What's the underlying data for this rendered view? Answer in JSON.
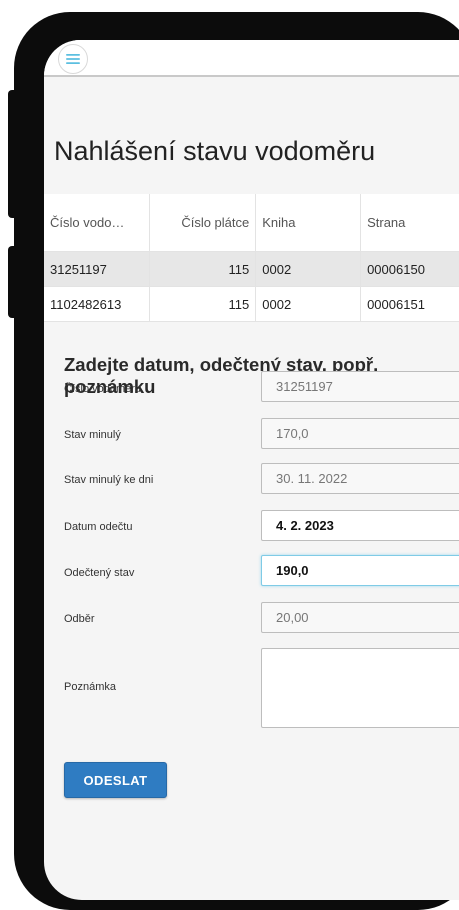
{
  "colors": {
    "accent": "#2f7cc2",
    "focus_border": "#7fcbe6",
    "menu_icon": "#5bbfe0"
  },
  "header": {
    "menu_icon": "hamburger-menu-icon"
  },
  "page": {
    "title": "Nahlášení stavu vodoměru"
  },
  "meter_table": {
    "columns": [
      "Číslo vodo…",
      "Číslo plátce",
      "Kniha",
      "Strana"
    ],
    "rows": [
      [
        "31251197",
        "115",
        "0002",
        "00006150"
      ],
      [
        "1102482613",
        "115",
        "0002",
        "00006151"
      ]
    ]
  },
  "form": {
    "heading": "Zadejte datum, odečtený stav, popř. poznámku",
    "fields": [
      {
        "label": "Číslo vodoměru",
        "value": "31251197"
      },
      {
        "label": "Stav minulý",
        "value": "170,0"
      },
      {
        "label": "Stav minulý ke dni",
        "value": "30. 11. 2022"
      },
      {
        "label": "Datum odečtu",
        "value": "4. 2. 2023"
      },
      {
        "label": "Odečtený stav",
        "value": "190,0"
      },
      {
        "label": "Odběr",
        "value": "20,00"
      }
    ],
    "note_label": "Poznámka",
    "note_value": "",
    "submit_label": "ODESLAT"
  }
}
